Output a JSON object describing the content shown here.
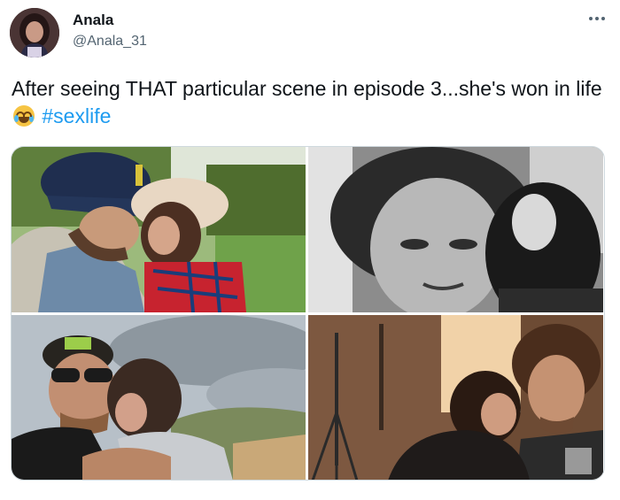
{
  "author": {
    "display_name": "Anala",
    "handle": "@Anala_31"
  },
  "tweet": {
    "text_before_emoji": "After seeing THAT particular scene in episode 3...she's won in life",
    "emoji": "face-with-tears-of-joy-icon",
    "hashtag": "#sexlife"
  },
  "media": {
    "count": 4,
    "photos": [
      {
        "description_icon": "couple-kissing-orchard-photo"
      },
      {
        "description_icon": "black-and-white-couple-selfie-photo"
      },
      {
        "description_icon": "couple-hugging-cloudy-field-photo"
      },
      {
        "description_icon": "couple-cuddling-film-set-photo"
      }
    ]
  },
  "colors": {
    "text": "#0f1419",
    "secondary": "#536471",
    "link": "#1d9bf0"
  }
}
